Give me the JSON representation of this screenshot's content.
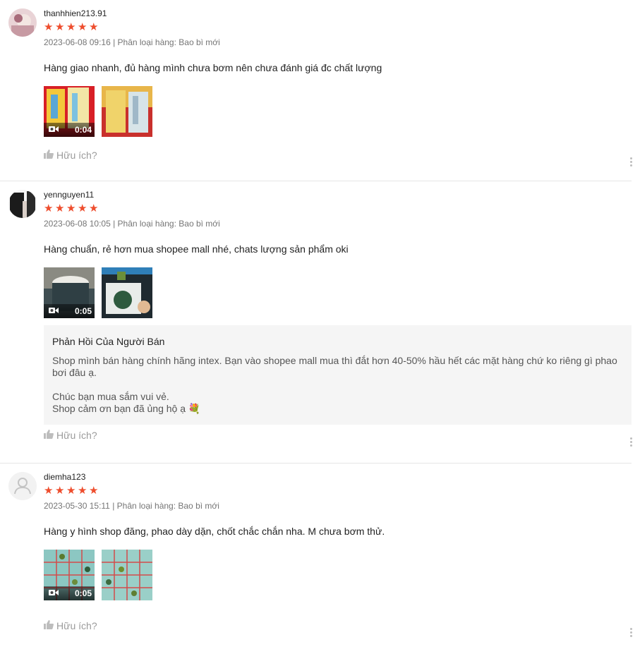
{
  "reviews": [
    {
      "username": "thanhhien213.91",
      "rating": 5,
      "meta": "2023-06-08 09:16 | Phân loại hàng: Bao bì mới",
      "comment": "Hàng giao nhanh, đủ hàng mình chưa bơm nên chưa đánh giá đc chất lượng",
      "video_duration": "0:04",
      "useful_label": "Hữu ích?"
    },
    {
      "username": "yennguyen11",
      "rating": 5,
      "meta": "2023-06-08 10:05 | Phân loại hàng: Bao bì mới",
      "comment": "Hàng chuẩn, rẻ hơn mua shopee mall nhé, chats lượng sản phẩm oki",
      "video_duration": "0:05",
      "seller_reply": {
        "title": "Phản Hồi Của Người Bán",
        "text": "Shop mình bán hàng chính hãng intex. Bạn vào shopee mall mua thì đắt hơn 40-50% hầu hết các mặt hàng chứ ko riêng gì phao bơi đâu ạ.\n\nChúc bạn mua sắm vui vẻ.\nShop cảm ơn bạn đã ủng hộ ạ 💐"
      },
      "useful_label": "Hữu ích?"
    },
    {
      "username": "diemha123",
      "rating": 5,
      "meta": "2023-05-30 15:11 | Phân loại hàng: Bao bì mới",
      "comment": "Hàng y hình shop đăng, phao dày dặn, chốt chắc chắn nha. M chưa bơm thử.",
      "video_duration": "0:05",
      "useful_label": "Hữu ích?"
    }
  ],
  "colors": {
    "star": "#ee4d2d",
    "meta": "#757575",
    "reply_bg": "#f5f5f5"
  },
  "icons": {
    "star": "★",
    "like": "thumbs-up-icon",
    "more": "more-vertical-icon",
    "video": "video-camera-icon"
  }
}
